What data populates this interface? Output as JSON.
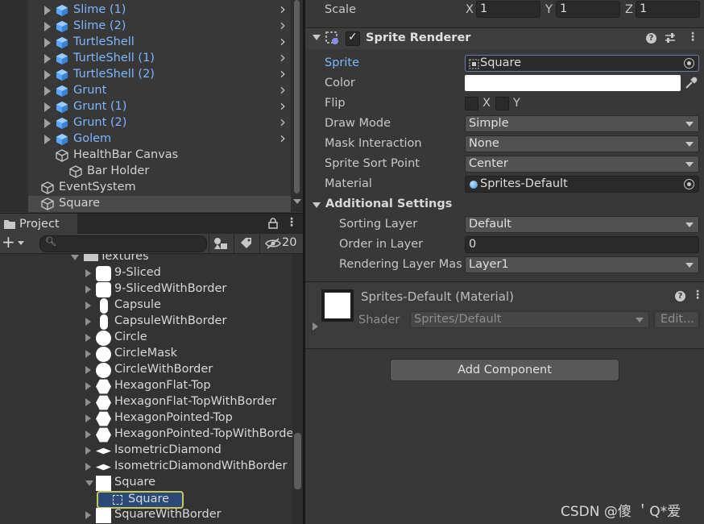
{
  "hierarchy": {
    "items": [
      {
        "label": "Slime (1)",
        "prefab": true
      },
      {
        "label": "Slime (2)",
        "prefab": true
      },
      {
        "label": "TurtleShell",
        "prefab": true
      },
      {
        "label": "TurtleShell (1)",
        "prefab": true
      },
      {
        "label": "TurtleShell (2)",
        "prefab": true
      },
      {
        "label": "Grunt",
        "prefab": true
      },
      {
        "label": "Grunt (1)",
        "prefab": true
      },
      {
        "label": "Grunt (2)",
        "prefab": true
      },
      {
        "label": "Golem",
        "prefab": true
      },
      {
        "label": "HealthBar Canvas",
        "prefab": false
      },
      {
        "label": "Bar Holder",
        "prefab": false
      },
      {
        "label": "EventSystem",
        "prefab": false
      },
      {
        "label": "Square",
        "prefab": false
      }
    ]
  },
  "project": {
    "tab_label": "Project",
    "search_placeholder": "",
    "hidden_count": "20",
    "folder": "Textures",
    "items": [
      {
        "label": "9-Sliced",
        "shape": "rounded"
      },
      {
        "label": "9-SlicedWithBorder",
        "shape": "rounded"
      },
      {
        "label": "Capsule",
        "shape": "capsule"
      },
      {
        "label": "CapsuleWithBorder",
        "shape": "capsule"
      },
      {
        "label": "Circle",
        "shape": "circle"
      },
      {
        "label": "CircleMask",
        "shape": "circle"
      },
      {
        "label": "CircleWithBorder",
        "shape": "circle"
      },
      {
        "label": "HexagonFlat-Top",
        "shape": "hex"
      },
      {
        "label": "HexagonFlat-TopWithBorder",
        "shape": "hex"
      },
      {
        "label": "HexagonPointed-Top",
        "shape": "hex"
      },
      {
        "label": "HexagonPointed-TopWithBorder",
        "shape": "hex"
      },
      {
        "label": "IsometricDiamond",
        "shape": "diamond"
      },
      {
        "label": "IsometricDiamondWithBorder",
        "shape": "diamond"
      },
      {
        "label": "Square",
        "shape": "square"
      },
      {
        "label": "Square",
        "shape": "sprite"
      },
      {
        "label": "SquareWithBorder",
        "shape": "square"
      }
    ]
  },
  "inspector": {
    "scale_label": "Scale",
    "scale": {
      "x_label": "X",
      "x": "1",
      "y_label": "Y",
      "y": "1",
      "z_label": "Z",
      "z": "1"
    },
    "component_title": "Sprite Renderer",
    "sprite_label": "Sprite",
    "sprite_value": "Square",
    "color_label": "Color",
    "color_value": "#ffffff",
    "flip_label": "Flip",
    "flip_x": "X",
    "flip_y": "Y",
    "draw_mode_label": "Draw Mode",
    "draw_mode_value": "Simple",
    "mask_label": "Mask Interaction",
    "mask_value": "None",
    "sort_point_label": "Sprite Sort Point",
    "sort_point_value": "Center",
    "material_label": "Material",
    "material_value": "Sprites-Default",
    "additional_label": "Additional Settings",
    "sorting_layer_label": "Sorting Layer",
    "sorting_layer_value": "Default",
    "order_label": "Order in Layer",
    "order_value": "0",
    "render_layer_label": "Rendering Layer Mas",
    "render_layer_value": "Layer1",
    "material_header": "Sprites-Default (Material)",
    "shader_label": "Shader",
    "shader_value": "Sprites/Default",
    "edit_label": "Edit...",
    "add_component": "Add Component"
  },
  "watermark": "CSDN @傻 ＇Q*爱"
}
